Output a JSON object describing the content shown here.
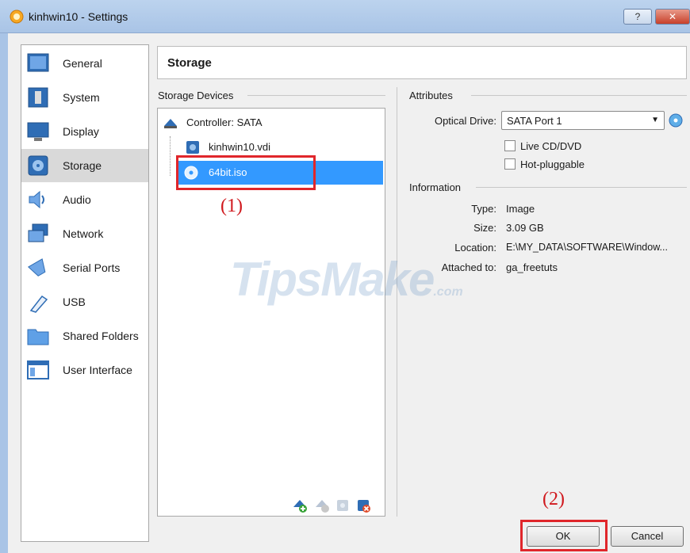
{
  "window": {
    "title": "kinhwin10 - Settings",
    "help_label": "?",
    "close_label": "✕"
  },
  "sidebar": {
    "items": [
      {
        "label": "General"
      },
      {
        "label": "System"
      },
      {
        "label": "Display"
      },
      {
        "label": "Storage",
        "active": true
      },
      {
        "label": "Audio"
      },
      {
        "label": "Network"
      },
      {
        "label": "Serial Ports"
      },
      {
        "label": "USB"
      },
      {
        "label": "Shared Folders"
      },
      {
        "label": "User Interface"
      }
    ]
  },
  "header": {
    "title": "Storage"
  },
  "storage_devices": {
    "section_label": "Storage Devices",
    "controller": "Controller: SATA",
    "items": [
      "kinhwin10.vdi",
      "64bit.iso"
    ],
    "selected": "64bit.iso"
  },
  "annotations": {
    "label1": "(1)",
    "label2": "(2)"
  },
  "attributes": {
    "section_label": "Attributes",
    "optical_drive_label": "Optical Drive:",
    "optical_drive_value": "SATA Port 1",
    "live_cd_label": "Live CD/DVD",
    "hot_pluggable_label": "Hot-pluggable"
  },
  "information": {
    "section_label": "Information",
    "type_label": "Type:",
    "type_value": "Image",
    "size_label": "Size:",
    "size_value": "3.09 GB",
    "location_label": "Location:",
    "location_value": "E:\\MY_DATA\\SOFTWARE\\Window...",
    "attached_label": "Attached to:",
    "attached_value": "ga_freetuts"
  },
  "watermark": {
    "main": "TipsMake",
    "suffix": ".com"
  },
  "buttons": {
    "ok": "OK",
    "cancel": "Cancel"
  },
  "colors": {
    "selection": "#3399ff",
    "annotation": "#e0262b",
    "titlebar": "#a9c4e6"
  }
}
